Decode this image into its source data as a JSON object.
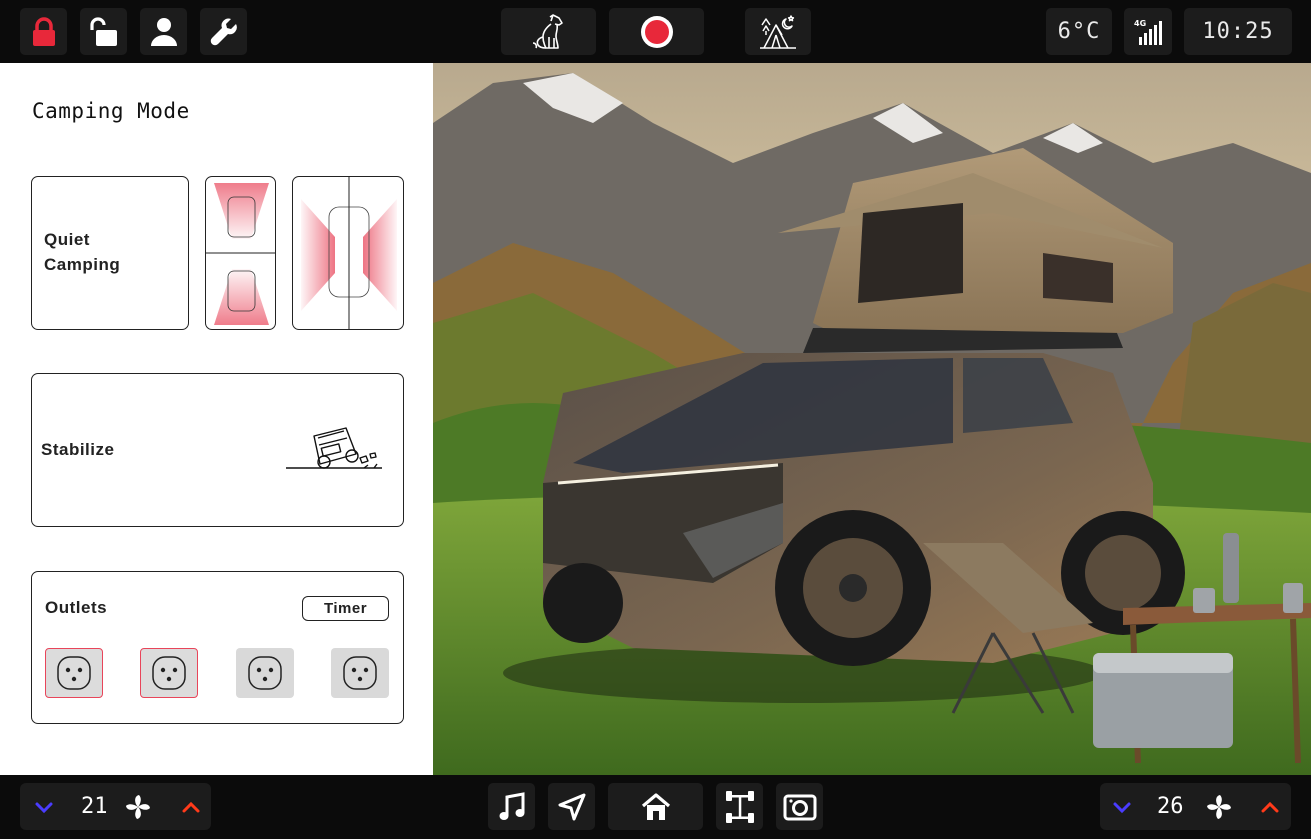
{
  "topbar": {
    "left_buttons": [
      "lock-icon",
      "unlock-icon",
      "user-icon",
      "wrench-icon"
    ],
    "mode_buttons": [
      "pet-mode-icon",
      "record-icon",
      "camping-mode-icon"
    ],
    "temperature": "6°C",
    "network": "4G",
    "clock": "10:25"
  },
  "panel": {
    "title": "Camping Mode",
    "quiet_camping": {
      "label_line1": "Quiet",
      "label_line2": "Camping"
    },
    "stabilize": {
      "label": "Stabilize"
    },
    "outlets": {
      "label": "Outlets",
      "timer_label": "Timer",
      "items": [
        {
          "state": "on"
        },
        {
          "state": "on"
        },
        {
          "state": "off"
        },
        {
          "state": "off"
        }
      ]
    }
  },
  "bottombar": {
    "left_climate": {
      "temperature": "21"
    },
    "right_climate": {
      "temperature": "26"
    },
    "nav_buttons": [
      "music-icon",
      "navigation-icon",
      "home-icon",
      "drivetrain-icon",
      "camera-icon"
    ]
  },
  "colors": {
    "lock_red": "#e8283a",
    "record_red": "#e8283a",
    "arrow_down": "#4a3cff",
    "arrow_up": "#ff3a1a",
    "outlet_active_border": "#e8455a"
  }
}
